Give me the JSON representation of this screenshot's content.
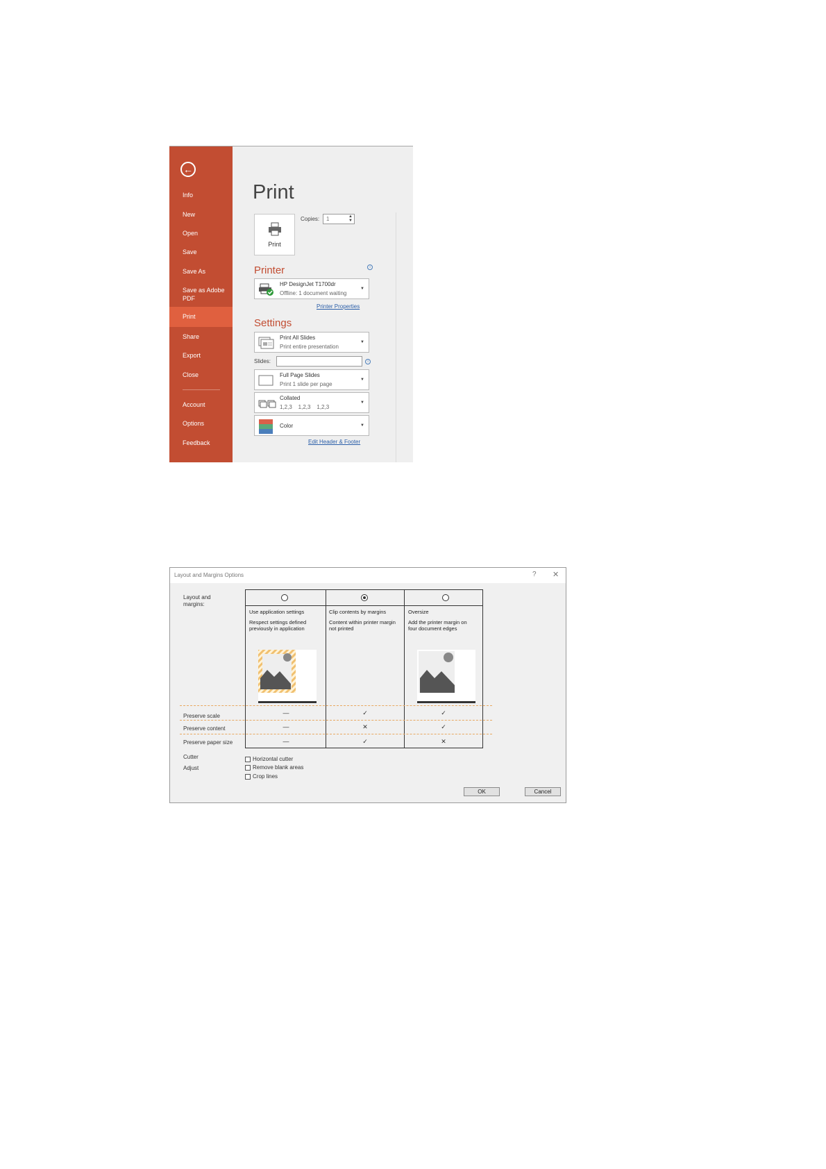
{
  "backstage": {
    "sidebar": {
      "items": [
        {
          "label": "Info"
        },
        {
          "label": "New"
        },
        {
          "label": "Open"
        },
        {
          "label": "Save"
        },
        {
          "label": "Save As"
        },
        {
          "label": "Save as Adobe",
          "label2": "PDF"
        },
        {
          "label": "Print"
        },
        {
          "label": "Share"
        },
        {
          "label": "Export"
        },
        {
          "label": "Close"
        },
        {
          "label": "Account"
        },
        {
          "label": "Options"
        },
        {
          "label": "Feedback"
        }
      ],
      "active": "Print",
      "accent": "#c24d32"
    },
    "title": "Print",
    "print_button": "Print",
    "copies_label": "Copies:",
    "copies_value": "1",
    "printer_heading": "Printer",
    "printer_name": "HP DesignJet T1700dr",
    "printer_status": "Offline: 1 document waiting",
    "printer_properties": "Printer Properties",
    "settings_heading": "Settings",
    "print_range_title": "Print All Slides",
    "print_range_sub": "Print entire presentation",
    "slides_label": "Slides:",
    "slides_value": "",
    "layout_title": "Full Page Slides",
    "layout_sub": "Print 1 slide per page",
    "collate_title": "Collated",
    "collate_sub": "1,2,3    1,2,3    1,2,3",
    "color_title": "Color",
    "edit_header_footer": "Edit Header & Footer"
  },
  "dialog": {
    "title": "Layout and Margins Options",
    "help": "?",
    "close": "✕",
    "layout_label_1": "Layout and",
    "layout_label_2": "margins:",
    "options": [
      {
        "title": "Use application settings",
        "desc_1": "Respect settings defined",
        "desc_2": "previously in application",
        "selected": false
      },
      {
        "title": "Clip contents by margins",
        "desc_1": "Content within printer margin",
        "desc_2": "not printed",
        "selected": true
      },
      {
        "title": "Oversize",
        "desc_1": "Add the printer margin on",
        "desc_2": "four document edges",
        "selected": false
      }
    ],
    "rows": [
      {
        "label": "Preserve scale",
        "marks": [
          "—",
          "✓",
          "✓"
        ]
      },
      {
        "label": "Preserve content",
        "marks": [
          "—",
          "✕",
          "✓"
        ]
      },
      {
        "label": "Preserve paper size",
        "marks": [
          "—",
          "✓",
          "✕"
        ]
      }
    ],
    "cutter_label": "Cutter",
    "adjust_label": "Adjust",
    "checkboxes": [
      "Horizontal cutter",
      "Remove blank areas",
      "Crop lines"
    ],
    "ok": "OK",
    "cancel": "Cancel"
  }
}
